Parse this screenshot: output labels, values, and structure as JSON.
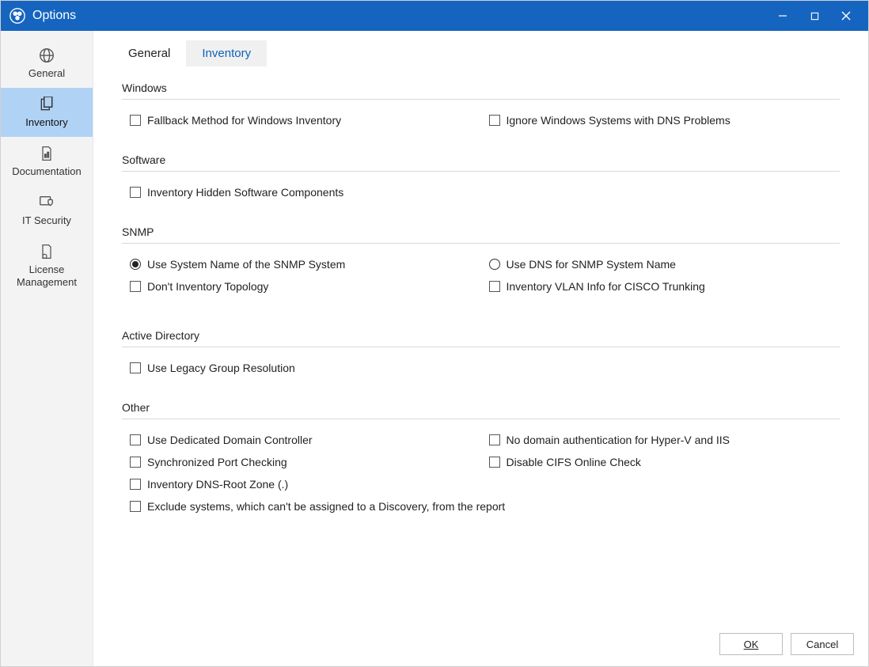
{
  "window": {
    "title": "Options"
  },
  "sidebar": {
    "items": [
      {
        "label": "General"
      },
      {
        "label": "Inventory"
      },
      {
        "label": "Documentation"
      },
      {
        "label": "IT Security"
      },
      {
        "label": "License Management"
      }
    ]
  },
  "tabs": [
    {
      "label": "General"
    },
    {
      "label": "Inventory"
    }
  ],
  "sections": {
    "windows": {
      "title": "Windows",
      "fallback": "Fallback Method for Windows Inventory",
      "ignore_dns": "Ignore Windows Systems with DNS Problems"
    },
    "software": {
      "title": "Software",
      "hidden": "Inventory Hidden Software Components"
    },
    "snmp": {
      "title": "SNMP",
      "use_system_name": "Use System Name of the SNMP System",
      "use_dns": "Use DNS for SNMP System Name",
      "dont_topology": "Don't Inventory Topology",
      "vlan_cisco": "Inventory VLAN Info for CISCO Trunking"
    },
    "ad": {
      "title": "Active Directory",
      "legacy_group": "Use Legacy Group Resolution"
    },
    "other": {
      "title": "Other",
      "dedicated_dc": "Use Dedicated Domain Controller",
      "no_domain_auth": "No domain authentication for Hyper-V and IIS",
      "sync_port": "Synchronized Port Checking",
      "disable_cifs": "Disable CIFS Online Check",
      "dns_root": "Inventory DNS-Root Zone (.)",
      "exclude_systems": "Exclude systems, which can't be assigned to a Discovery, from the report"
    }
  },
  "buttons": {
    "ok": "OK",
    "cancel": "Cancel"
  }
}
